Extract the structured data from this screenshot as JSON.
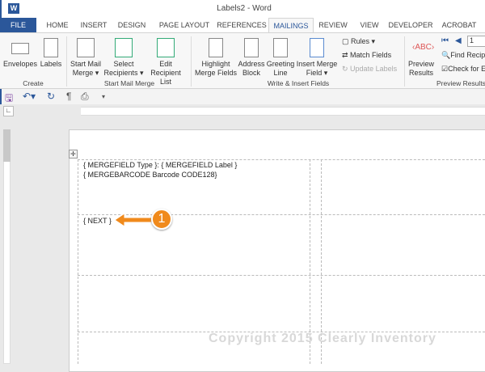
{
  "window": {
    "title": "Labels2 - Word",
    "app_icon": "W"
  },
  "tabs": [
    "FILE",
    "HOME",
    "INSERT",
    "DESIGN",
    "PAGE LAYOUT",
    "REFERENCES",
    "MAILINGS",
    "REVIEW",
    "VIEW",
    "DEVELOPER",
    "ACROBAT"
  ],
  "ribbon": {
    "create": {
      "label": "Create",
      "envelopes": "Envelopes",
      "labels": "Labels"
    },
    "start": {
      "label": "Start Mail Merge",
      "start_mail": "Start Mail",
      "merge": "Merge",
      "select": "Select",
      "recipients": "Recipients",
      "edit": "Edit",
      "recipient_list": "Recipient List"
    },
    "write": {
      "label": "Write & Insert Fields",
      "highlight": "Highlight",
      "merge_fields": "Merge Fields",
      "address": "Address",
      "block": "Block",
      "greeting": "Greeting",
      "line": "Line",
      "insert_merge": "Insert Merge",
      "field": "Field",
      "rules": "Rules",
      "match": "Match Fields",
      "update": "Update Labels"
    },
    "preview": {
      "label": "Preview Results",
      "preview": "Preview",
      "results": "Results",
      "record": "1",
      "find": "Find Recipient",
      "check": "Check for Errors"
    }
  },
  "document": {
    "line1": "{ MERGEFIELD Type }:  { MERGEFIELD Label }",
    "line2": "{ MERGEBARCODE Barcode CODE128}",
    "next": "{ NEXT }",
    "callout": "1",
    "watermark": "Copyright 2015 Clearly Inventory"
  },
  "colors": {
    "accent": "#2b579a",
    "callout": "#f08a1c"
  }
}
